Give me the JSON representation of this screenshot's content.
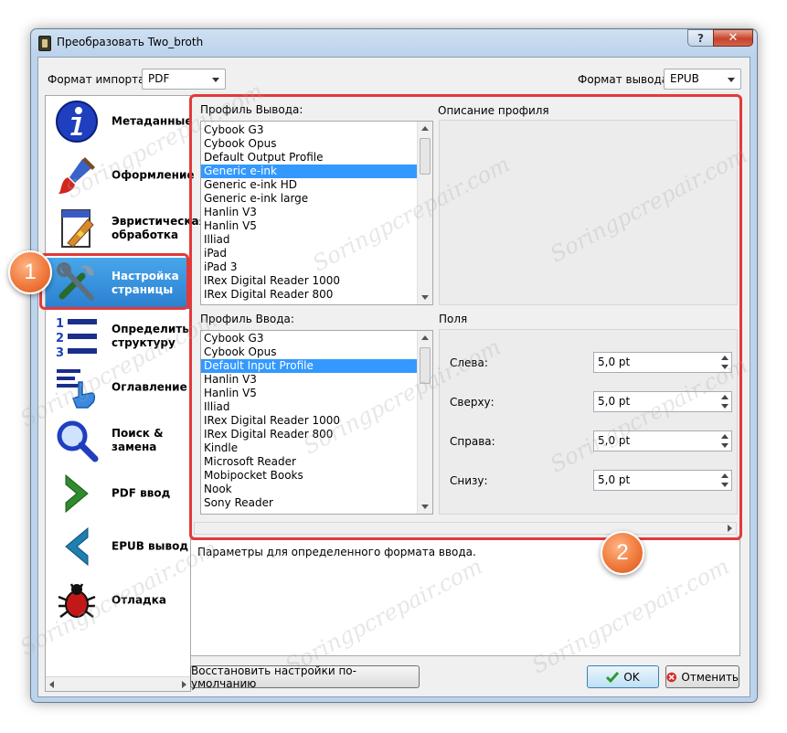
{
  "window": {
    "title": "Преобразовать Two_broth",
    "help_label": "?",
    "close_label": "✕"
  },
  "import_format": {
    "label": "Формат импорта:",
    "value": "PDF"
  },
  "output_format": {
    "label": "Формат вывода:",
    "value": "EPUB"
  },
  "sidebar": {
    "items": [
      {
        "label": "Метаданные",
        "icon": "info-icon"
      },
      {
        "label": "Оформление",
        "icon": "paintbrush-icon"
      },
      {
        "label": "Эвристическая обработка",
        "icon": "document-wand-icon"
      },
      {
        "label": "Настройка страницы",
        "icon": "tools-icon"
      },
      {
        "label": "Определить структуру",
        "icon": "numbered-list-icon"
      },
      {
        "label": "Оглавление",
        "icon": "toc-hand-icon"
      },
      {
        "label": "Поиск & замена",
        "icon": "magnifier-icon"
      },
      {
        "label": "PDF ввод",
        "icon": "arrow-right-icon"
      },
      {
        "label": "EPUB вывод",
        "icon": "arrow-left-icon"
      },
      {
        "label": "Отладка",
        "icon": "bug-icon"
      }
    ],
    "active_index": 3
  },
  "output_profile": {
    "label": "Профиль Вывода:",
    "items": [
      "Cybook G3",
      "Cybook Opus",
      "Default Output Profile",
      "Generic e-ink",
      "Generic e-ink HD",
      "Generic e-ink large",
      "Hanlin V3",
      "Hanlin V5",
      "Illiad",
      "iPad",
      "iPad 3",
      "IRex Digital Reader 1000",
      "IRex Digital Reader 800"
    ],
    "selected_index": 3
  },
  "profile_description": {
    "label": "Описание профиля"
  },
  "input_profile": {
    "label": "Профиль Ввода:",
    "items": [
      "Cybook G3",
      "Cybook Opus",
      "Default Input Profile",
      "Hanlin V3",
      "Hanlin V5",
      "Illiad",
      "IRex Digital Reader 1000",
      "IRex Digital Reader 800",
      "Kindle",
      "Microsoft Reader",
      "Mobipocket Books",
      "Nook",
      "Sony Reader"
    ],
    "selected_index": 2
  },
  "margins": {
    "label": "Поля",
    "left": {
      "label": "Слева:",
      "value": "5,0 pt"
    },
    "top": {
      "label": "Сверху:",
      "value": "5,0 pt"
    },
    "right": {
      "label": "Справа:",
      "value": "5,0 pt"
    },
    "bottom": {
      "label": "Снизу:",
      "value": "5,0 pt"
    }
  },
  "help_text": "Параметры для определенного формата ввода.",
  "buttons": {
    "restore": "Восстановить настройки по-умолчанию",
    "ok": "OK",
    "cancel": "Отменить"
  },
  "annotations": {
    "badge1": "1",
    "badge2": "2"
  },
  "watermark": "Soringpcrepair.com",
  "colors": {
    "selection": "#3399ff",
    "highlight": "#e23a3a",
    "badge": "#f07a3c"
  }
}
